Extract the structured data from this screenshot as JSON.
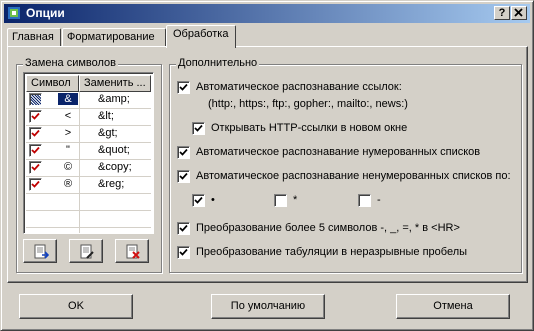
{
  "window": {
    "title": "Опции",
    "help_button": "?",
    "close_button": "✕"
  },
  "tabs": [
    "Главная",
    "Форматирование",
    "Обработка"
  ],
  "symbol_group": {
    "title": "Замена символов",
    "columns": [
      "Символ",
      "Заменить ..."
    ],
    "rows": [
      {
        "symbol": "&",
        "replace": "&amp;",
        "checked": true,
        "selected": true
      },
      {
        "symbol": "<",
        "replace": "&lt;",
        "checked": true
      },
      {
        "symbol": ">",
        "replace": "&gt;",
        "checked": true
      },
      {
        "symbol": "\"",
        "replace": "&quot;",
        "checked": true
      },
      {
        "symbol": "©",
        "replace": "&copy;",
        "checked": true
      },
      {
        "symbol": "®",
        "replace": "&reg;",
        "checked": true
      }
    ],
    "buttons": [
      "add-icon",
      "edit-icon",
      "delete-icon"
    ]
  },
  "extra_group": {
    "title": "Дополнительно",
    "auto_links": "Автоматическое распознавание ссылок:",
    "auto_links_note": "(http:, https:, ftp:, gopher:, mailto:, news:)",
    "open_http": "Открывать HTTP-ссылки в новом окне",
    "numbered_lists": "Автоматическое распознавание нумерованных списков",
    "unnumbered_lists": "Автоматическое распознавание ненумерованных списков по:",
    "bullet1": "•",
    "bullet2": "*",
    "bullet3": "-",
    "hr_conversion": "Преобразование более 5 символов -, _, =, * в <HR>",
    "tab_conversion": "Преобразование табуляции в неразрывные пробелы"
  },
  "footer": {
    "ok": "OK",
    "defaults": "По умолчанию",
    "cancel": "Отмена"
  }
}
